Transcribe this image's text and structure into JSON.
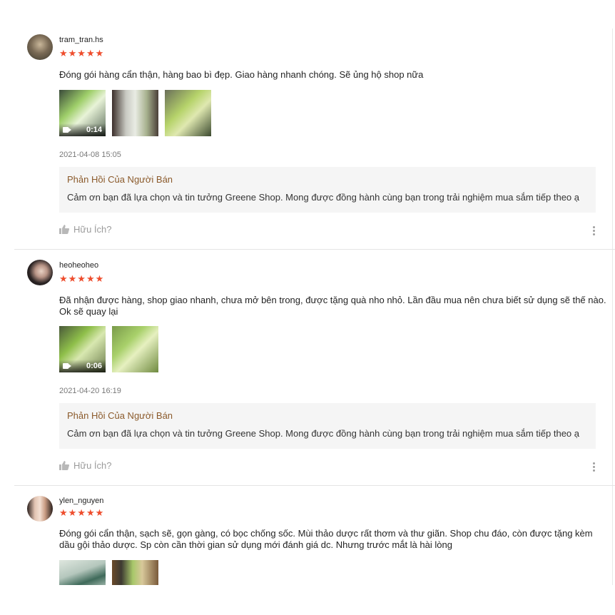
{
  "reviews": [
    {
      "username": "tram_tran.hs",
      "rating": 5,
      "stars": "★★★★★",
      "content": "Đóng gói hàng cẩn thận, hàng bao bì đẹp. Giao hàng nhanh chóng. Sẽ ủng hộ shop nữa",
      "video_duration": "0:14",
      "image_count": 3,
      "timestamp": "2021-04-08 15:05",
      "seller_reply_title": "Phản Hồi Của Người Bán",
      "seller_reply_text": "Cảm ơn bạn đã lựa chọn và tin tưởng Greene Shop. Mong được đồng hành cùng bạn trong trải nghiệm mua sắm tiếp theo ạ",
      "helpful_label": "Hữu Ích?"
    },
    {
      "username": "heoheoheo",
      "rating": 5,
      "stars": "★★★★★",
      "content": "Đã nhận được hàng, shop giao nhanh, chưa mở bên trong, được tặng quà nho nhỏ. Lần đầu mua nên chưa biết sử dụng sẽ thế nào. Ok sẽ quay lại",
      "video_duration": "0:06",
      "image_count": 2,
      "timestamp": "2021-04-20 16:19",
      "seller_reply_title": "Phản Hồi Của Người Bán",
      "seller_reply_text": "Cảm ơn bạn đã lựa chọn và tin tưởng Greene Shop. Mong được đồng hành cùng bạn trong trải nghiệm mua sắm tiếp theo ạ",
      "helpful_label": "Hữu Ích?"
    },
    {
      "username": "ylen_nguyen",
      "rating": 5,
      "stars": "★★★★★",
      "content": "Đóng gói cẩn thận, sạch sẽ, gọn gàng, có bọc chống sốc. Mùi thảo dược rất thơm và thư giãn. Shop chu đáo, còn được tặng kèm dầu gội thảo dược. Sp còn cần thời gian sử dụng mới đánh giá dc. Nhưng trước mắt là hài lòng",
      "image_count": 2
    }
  ],
  "colors": {
    "star": "#ee4d2d",
    "reply_title": "#8b5a2b",
    "reply_bg": "#f5f5f5"
  },
  "icons": [
    "thumbs-up-icon",
    "more-vertical-icon",
    "video-camera-icon"
  ]
}
